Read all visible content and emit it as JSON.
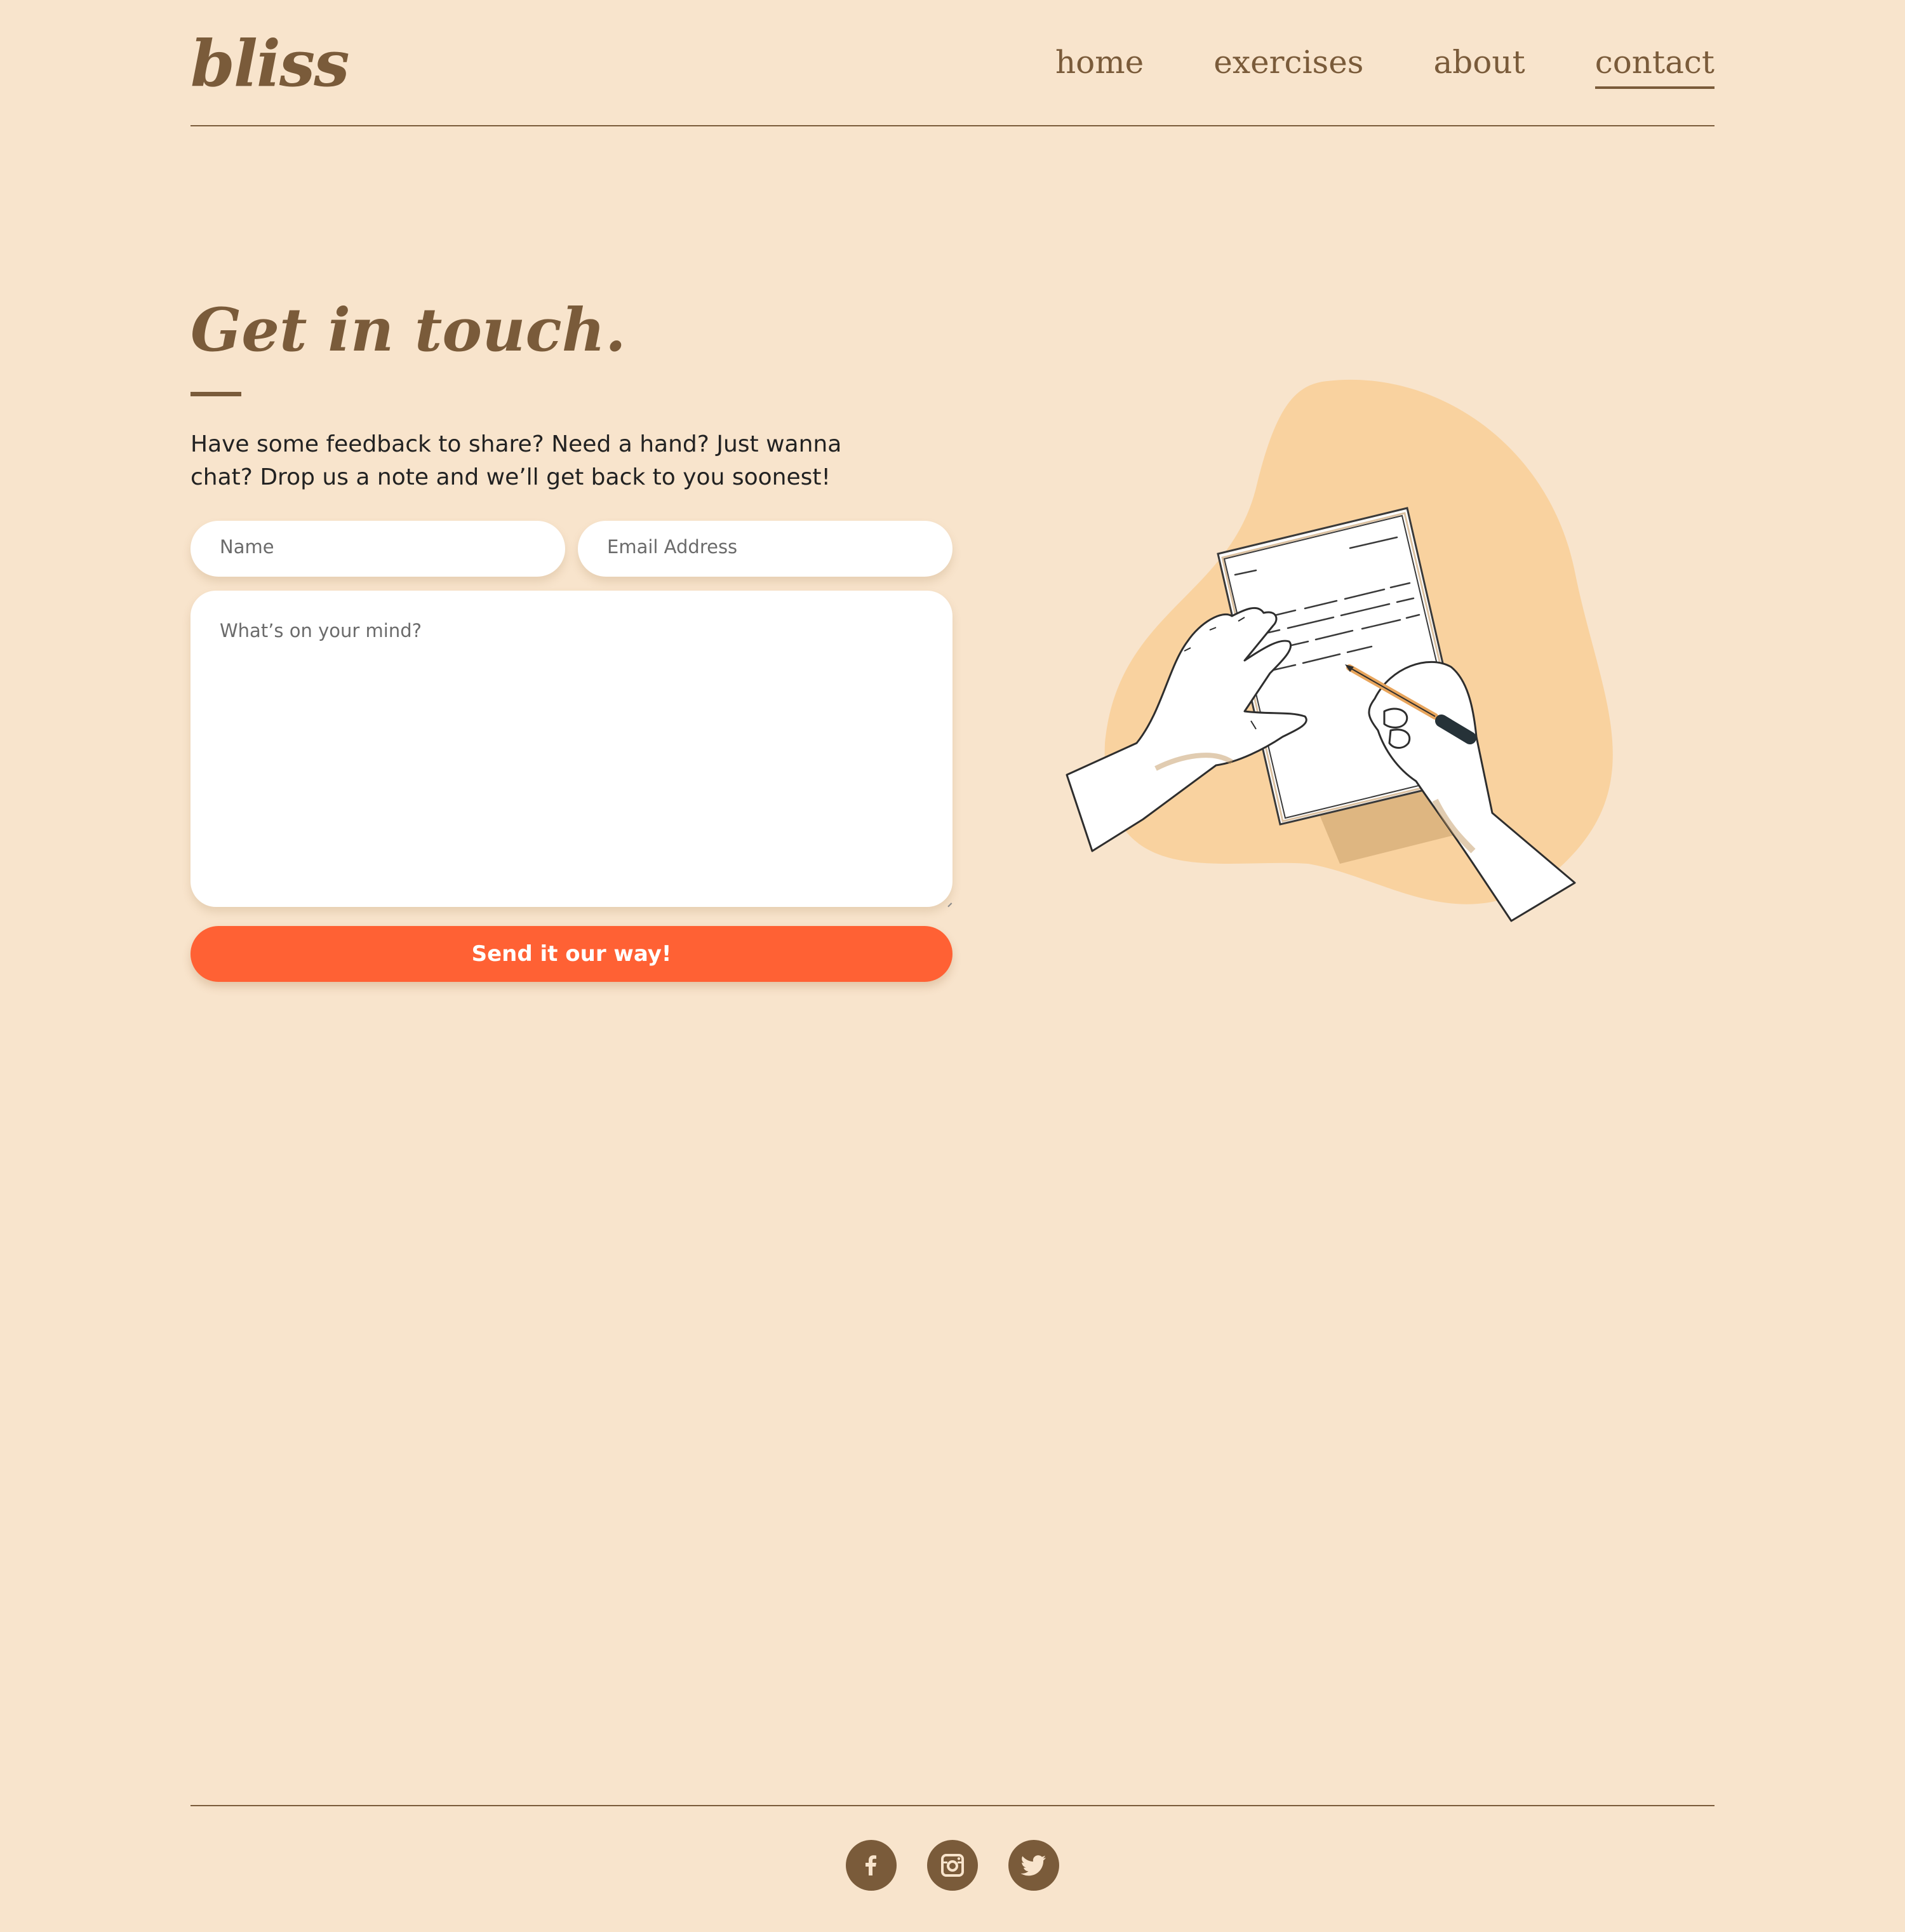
{
  "header": {
    "brand": "bliss",
    "nav": [
      {
        "label": "home",
        "active": false
      },
      {
        "label": "exercises",
        "active": false
      },
      {
        "label": "about",
        "active": false
      },
      {
        "label": "contact",
        "active": true
      }
    ]
  },
  "main": {
    "title": "Get in touch.",
    "intro": "Have some feedback to share? Need a hand? Just wanna chat? Drop us a note and we’ll get back to you soonest!",
    "form": {
      "name_placeholder": "Name",
      "email_placeholder": "Email Address",
      "message_placeholder": "What’s on your mind?",
      "submit_label": "Send it our way!"
    }
  },
  "footer": {
    "social": [
      {
        "icon": "facebook-icon"
      },
      {
        "icon": "instagram-icon"
      },
      {
        "icon": "twitter-icon"
      }
    ]
  },
  "colors": {
    "background": "#f8e4cc",
    "brand_brown": "#7a5b3a",
    "accent_orange": "#ff6134",
    "blob": "#f9d29f",
    "input_background": "#ffffff"
  }
}
